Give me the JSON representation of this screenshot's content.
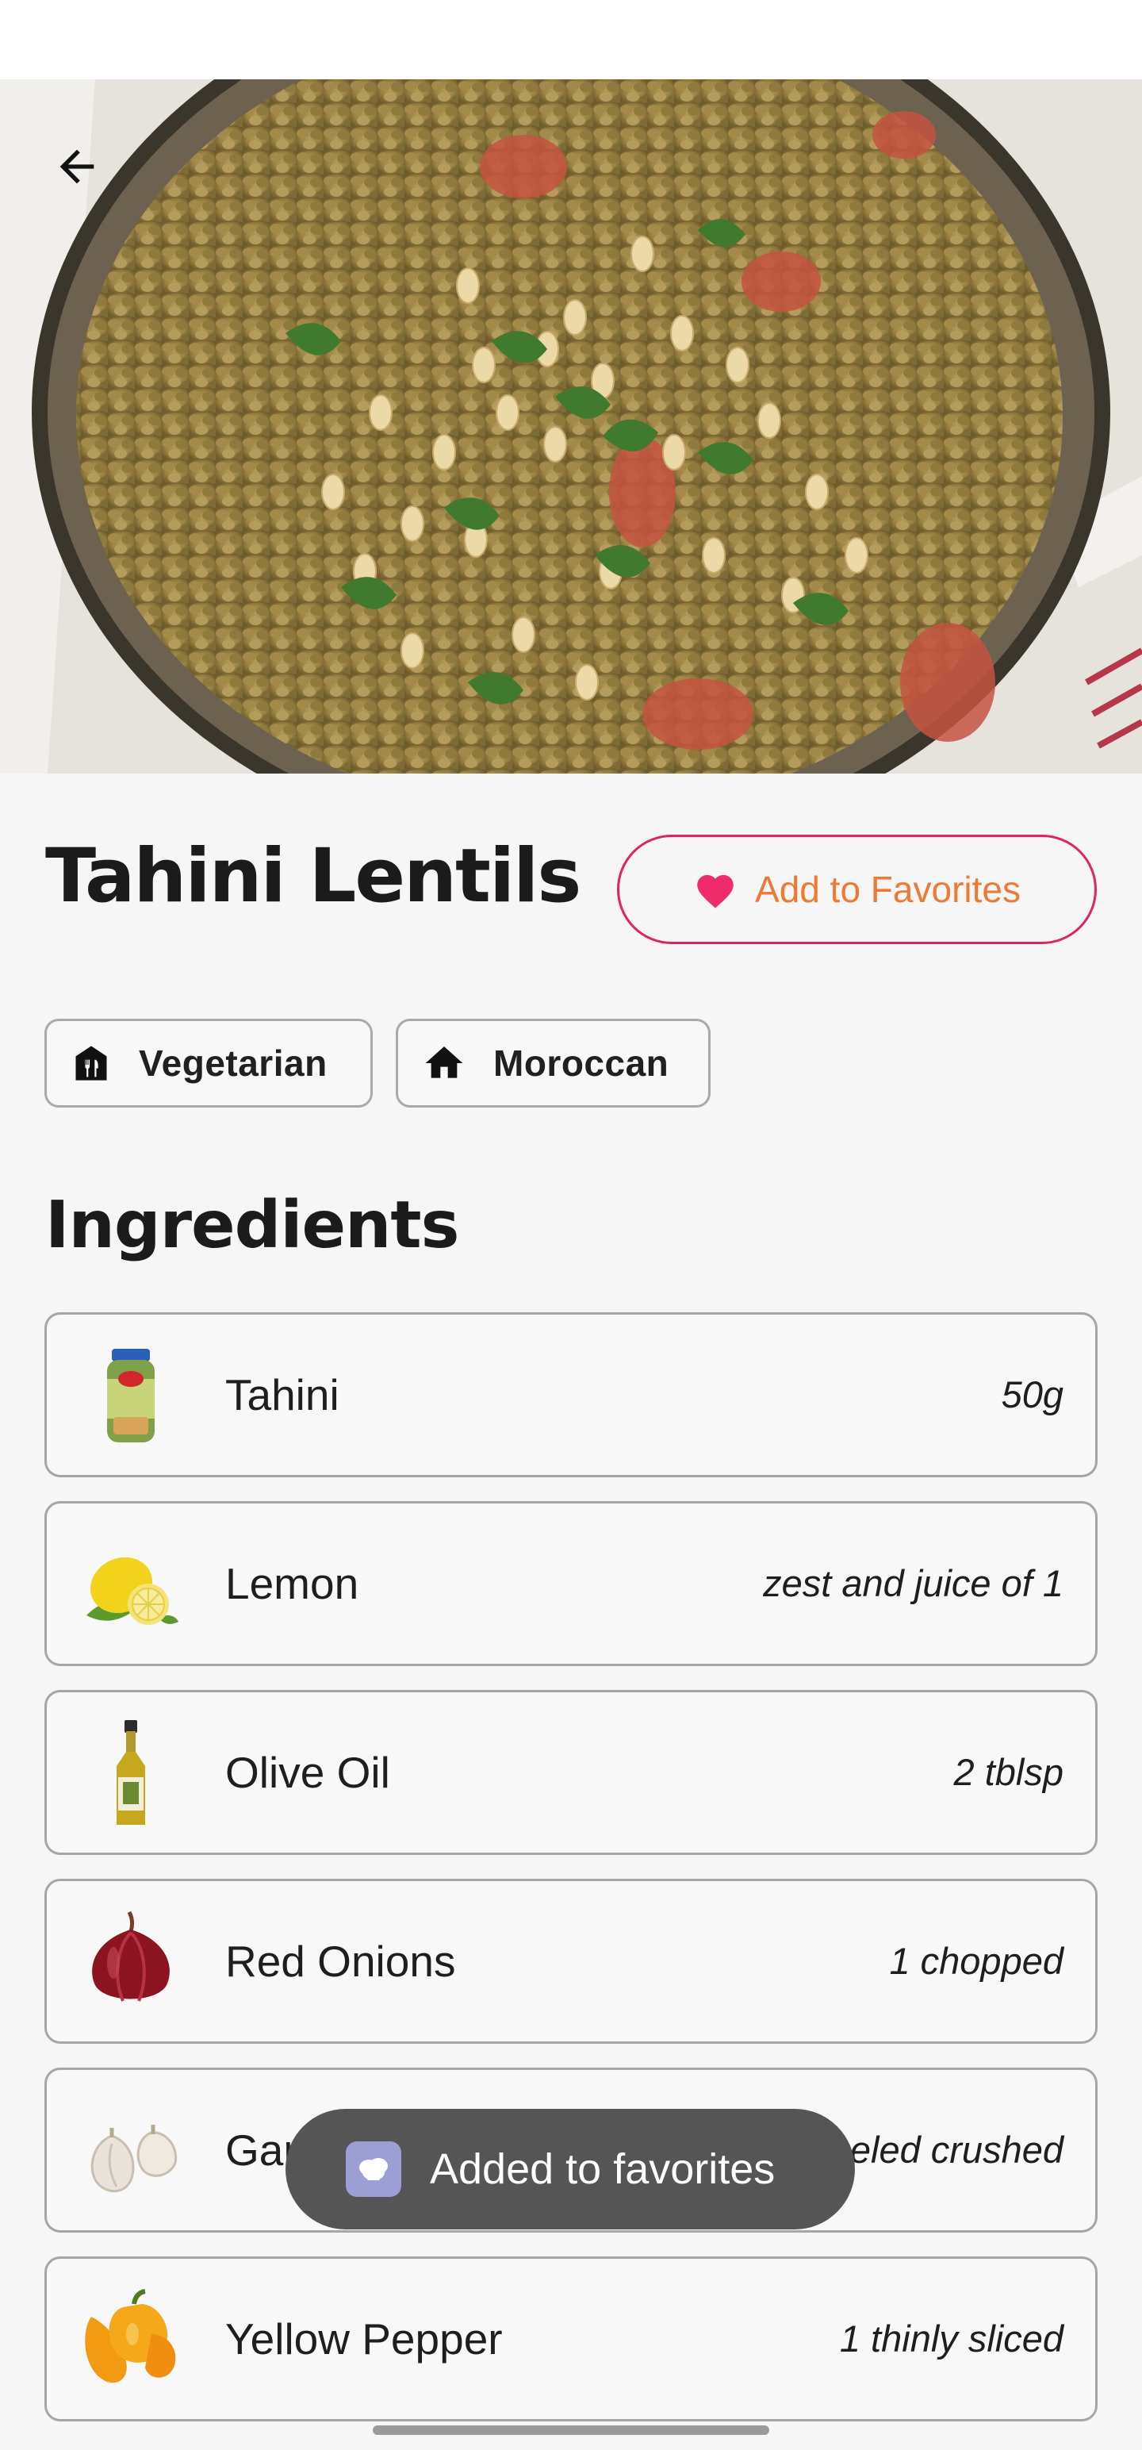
{
  "recipe": {
    "title": "Tahini Lentils",
    "favorite_button_label": "Add to Favorites"
  },
  "tags": [
    {
      "label": "Vegetarian",
      "icon": "vegetarian-restaurant-icon"
    },
    {
      "label": "Moroccan",
      "icon": "home-icon"
    }
  ],
  "ingredients_section": {
    "title": "Ingredients",
    "items": [
      {
        "name": "Tahini",
        "quantity": "50g",
        "icon": "tahini-jar-icon"
      },
      {
        "name": "Lemon",
        "quantity": "zest and juice of 1",
        "icon": "lemon-icon"
      },
      {
        "name": "Olive Oil",
        "quantity": "2 tblsp",
        "icon": "olive-oil-bottle-icon"
      },
      {
        "name": "Red Onions",
        "quantity": "1 chopped",
        "icon": "red-onion-icon"
      },
      {
        "name": "Garlic",
        "quantity": "1 clove peeled crushed",
        "icon": "garlic-icon"
      },
      {
        "name": "Yellow Pepper",
        "quantity": "1 thinly sliced",
        "icon": "yellow-pepper-icon"
      }
    ]
  },
  "toast": {
    "message": "Added to favorites",
    "icon": "app-icon"
  },
  "colors": {
    "accent_border": "#e0245e",
    "accent_heart": "#ef2b6b",
    "accent_text": "#ee7a36",
    "toast_bg": "#555555"
  }
}
